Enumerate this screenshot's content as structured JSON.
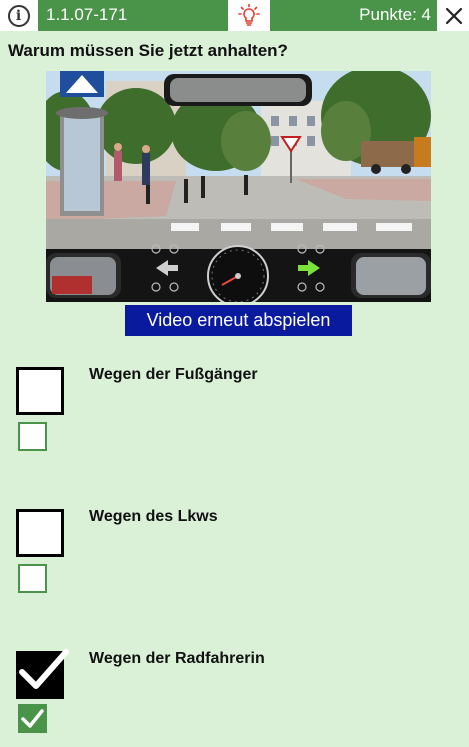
{
  "topbar": {
    "question_code": "1.1.07-171",
    "points_label": "Punkte: 4"
  },
  "icons": {
    "info": "info-icon",
    "hint": "lightbulb-icon",
    "close": "close-icon"
  },
  "question": "Warum müssen Sie jetzt anhalten?",
  "video": {
    "replay_label": "Video erneut abspielen"
  },
  "answers": [
    {
      "text": "Wegen der Fußgänger",
      "selected": false,
      "correct": false
    },
    {
      "text": "Wegen des Lkws",
      "selected": false,
      "correct": false
    },
    {
      "text": "Wegen der Radfahrerin",
      "selected": true,
      "correct": true
    }
  ],
  "colors": {
    "background": "#daf1d8",
    "accent_green": "#4a9449",
    "replay_button": "#0a1a9e",
    "hint_icon": "#e63a2e"
  }
}
